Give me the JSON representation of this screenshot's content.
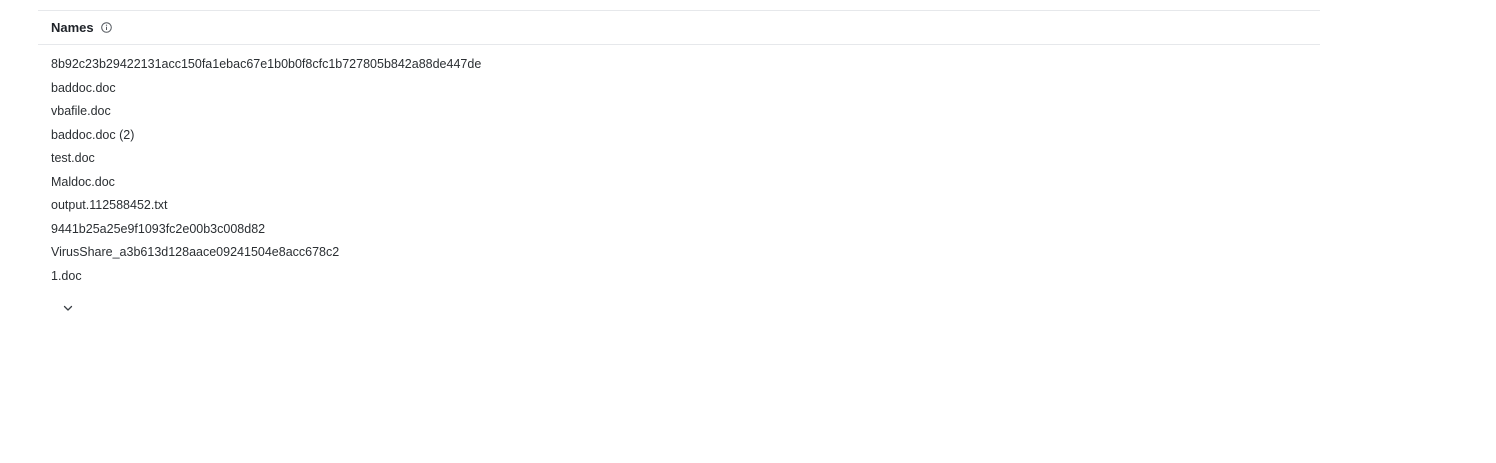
{
  "section": {
    "title": "Names",
    "icon": "info-icon"
  },
  "names": [
    "8b92c23b29422131acc150fa1ebac67e1b0b0f8cfc1b727805b842a88de447de",
    "baddoc.doc",
    "vbafile.doc",
    "baddoc.doc (2)",
    "test.doc",
    "Maldoc.doc",
    "output.112588452.txt",
    "9441b25a25e9f1093fc2e00b3c008d82",
    "VirusShare_a3b613d128aace09241504e8acc678c2",
    "1.doc"
  ],
  "expand_control": {
    "icon": "chevron-down-icon"
  },
  "colors": {
    "divider": "#e6e8eb",
    "text": "#2b2f33"
  }
}
